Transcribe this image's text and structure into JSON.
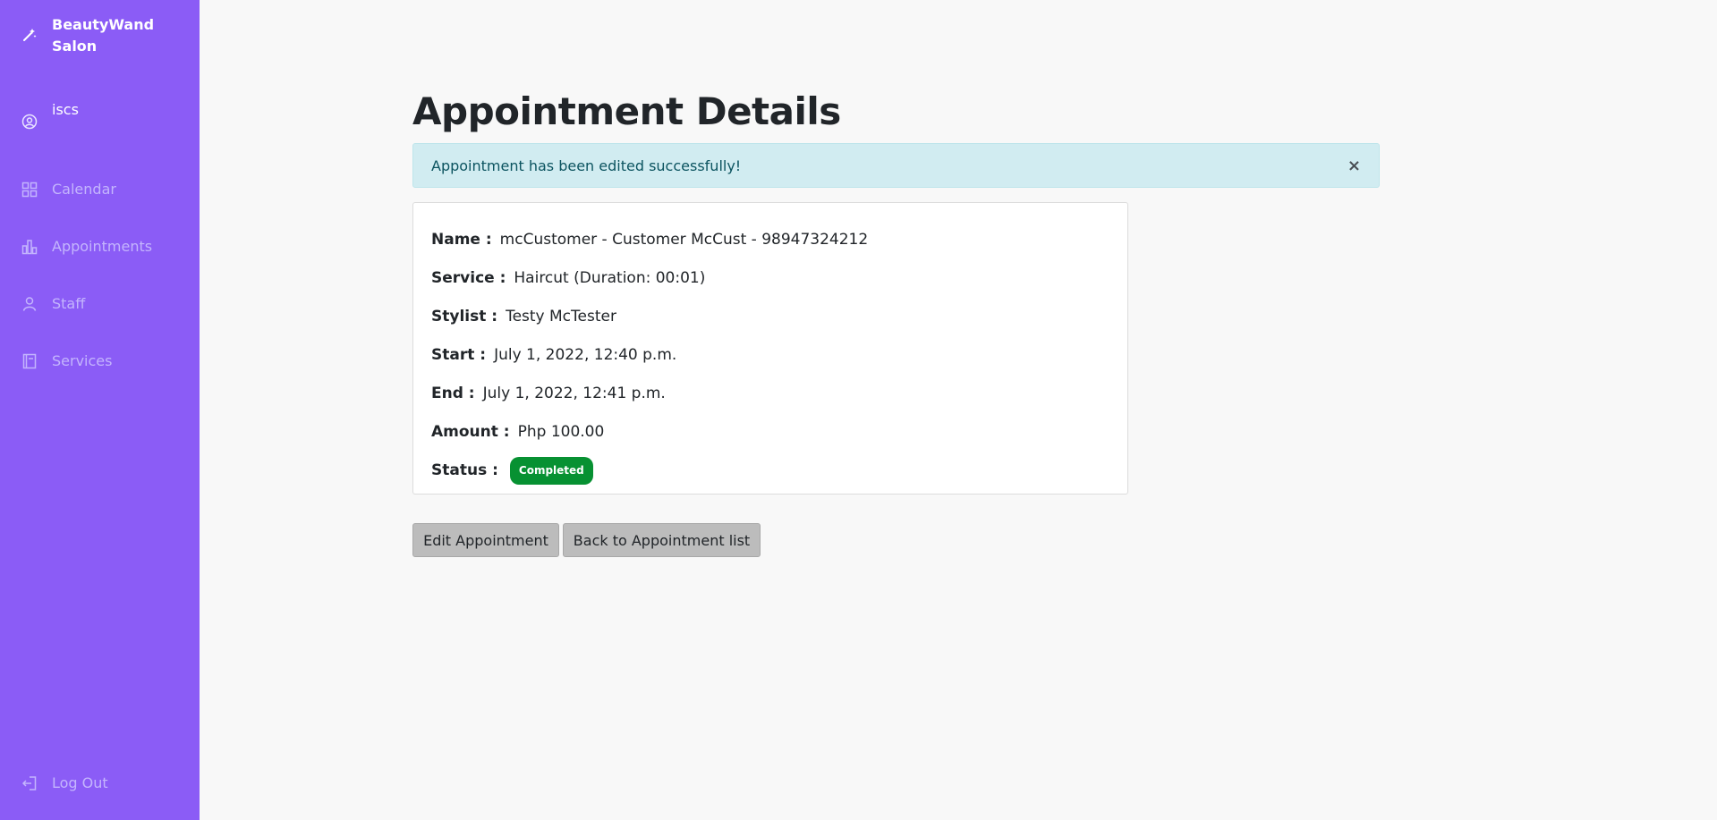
{
  "sidebar": {
    "brand": "BeautyWand Salon",
    "user": "iscs",
    "nav": [
      {
        "label": "Calendar",
        "icon": "grid-icon"
      },
      {
        "label": "Appointments",
        "icon": "bar-chart-icon"
      },
      {
        "label": "Staff",
        "icon": "person-icon"
      },
      {
        "label": "Services",
        "icon": "book-icon"
      }
    ],
    "logout": "Log Out"
  },
  "page": {
    "title": "Appointment Details",
    "alert": "Appointment has been edited successfully!",
    "alert_close": "×"
  },
  "details": {
    "name_label": "Name :",
    "name": "mcCustomer - Customer McCust - 98947324212",
    "service_label": "Service :",
    "service": "Haircut (Duration: 00:01)",
    "stylist_label": "Stylist :",
    "stylist": "Testy McTester",
    "start_label": "Start :",
    "start": "July 1, 2022, 12:40 p.m.",
    "end_label": "End :",
    "end": "July 1, 2022, 12:41 p.m.",
    "amount_label": "Amount :",
    "amount": "Php 100.00",
    "status_label": "Status :",
    "status": "Completed"
  },
  "actions": {
    "edit": "Edit Appointment",
    "back": "Back to Appointment list"
  },
  "colors": {
    "sidebar": "#8b5cf6",
    "alert_bg": "#d1ecf1",
    "status_badge": "#079132"
  }
}
